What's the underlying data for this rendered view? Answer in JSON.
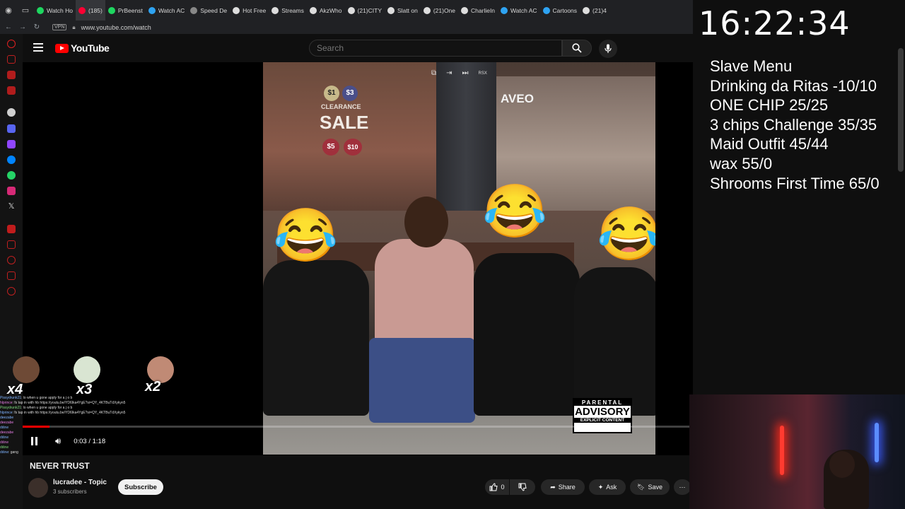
{
  "browser": {
    "tabs": [
      {
        "icon": "twitch-icon",
        "title": "Watch Ho",
        "color": "#1ed760"
      },
      {
        "icon": "youtube-icon",
        "title": "(185)",
        "color": "#ff0033",
        "active": true
      },
      {
        "icon": "twitch-icon",
        "title": "PrBeenst",
        "color": "#1ed760"
      },
      {
        "icon": "globe-icon",
        "title": "Watch AC",
        "color": "#2ea3f2"
      },
      {
        "icon": "grid-icon",
        "title": "Speed De",
        "color": "#888888"
      },
      {
        "icon": "x-icon",
        "title": "Hot Free",
        "color": "#dddddd"
      },
      {
        "icon": "x-icon",
        "title": "Streams",
        "color": "#dddddd"
      },
      {
        "icon": "x-icon",
        "title": "AkzWho",
        "color": "#dddddd"
      },
      {
        "icon": "tiktok-icon",
        "title": "(21)CITY",
        "color": "#dddddd"
      },
      {
        "icon": "x-icon",
        "title": "Slatt on",
        "color": "#dddddd"
      },
      {
        "icon": "tiktok-icon",
        "title": "(21)One",
        "color": "#dddddd"
      },
      {
        "icon": "x-icon",
        "title": "CharlieIn",
        "color": "#dddddd"
      },
      {
        "icon": "globe-icon",
        "title": "Watch AC",
        "color": "#2ea3f2"
      },
      {
        "icon": "globe-icon",
        "title": "Cartoons",
        "color": "#2ea3f2"
      },
      {
        "icon": "tiktok-icon",
        "title": "(21)4",
        "color": "#dddddd"
      }
    ],
    "vpn_label": "VPN",
    "url": "www.youtube.com/watch"
  },
  "youtube": {
    "logo_text": "YouTube",
    "search_placeholder": "Search",
    "player": {
      "current_time": "0:03",
      "duration": "1:18",
      "time_display": "0:03 / 1:18",
      "progress_fraction": 0.04,
      "rsx_label": "RSX",
      "advisory": {
        "line1": "PARENTAL",
        "line2": "ADVISORY",
        "line3": "EXPLICIT CONTENT"
      },
      "signs": {
        "clearance": "CLEARANCE",
        "sale": "SALE",
        "aveo": "AVEO",
        "price1": "$1",
        "price2": "$3",
        "price3": "$5",
        "price4": "$10"
      }
    },
    "video": {
      "title": "NEVER TRUST",
      "channel_name": "lucradee - Topic",
      "subscribers": "3 subscribers",
      "subscribe_label": "Subscribe",
      "likes": "0",
      "share_label": "Share",
      "ask_label": "Ask",
      "save_label": "Save"
    }
  },
  "chat": {
    "combo": [
      {
        "label": "x4"
      },
      {
        "label": "x3"
      },
      {
        "label": "x2"
      }
    ],
    "lines": [
      {
        "user": "Pissydrunk21",
        "text": ": lo when u gone apply for a j o b"
      },
      {
        "user": "hlprince",
        "text": ": fs tap in with hb https://youtu.be/YD6Ika4YgE?si=QY_4KTBuTdXykyn5"
      },
      {
        "user": "Pissydrunk21",
        "text": ": lo when u gone apply for a j o b"
      },
      {
        "user": "hlprince",
        "text": ": fs tap in with hb https://youtu.be/YD6Ika4YgE?si=QY_4KTBuTdXykyn5"
      },
      {
        "user": "",
        "text": ""
      },
      {
        "user": "",
        "text": ""
      },
      {
        "user": "deezabe",
        "text": ""
      },
      {
        "user": "deezabe",
        "text": ""
      },
      {
        "user": "",
        "text": ""
      },
      {
        "user": "ddow",
        "text": ""
      },
      {
        "user": "deezabe",
        "text": ""
      },
      {
        "user": "",
        "text": ""
      },
      {
        "user": "ddow",
        "text": ""
      },
      {
        "user": "ddow",
        "text": ""
      },
      {
        "user": "ddow",
        "text": ""
      },
      {
        "user": "ddow",
        "text": ": gang"
      }
    ]
  },
  "stream_overlay": {
    "clock": "16:22:34",
    "menu": [
      "Slave Menu",
      "Drinking da Ritas -10/10",
      "ONE CHIP 25/25",
      "3 chips  Challenge  35/35",
      "Maid Outfit 45/44",
      "wax 55/0",
      "Shrooms First Time 65/0"
    ]
  }
}
